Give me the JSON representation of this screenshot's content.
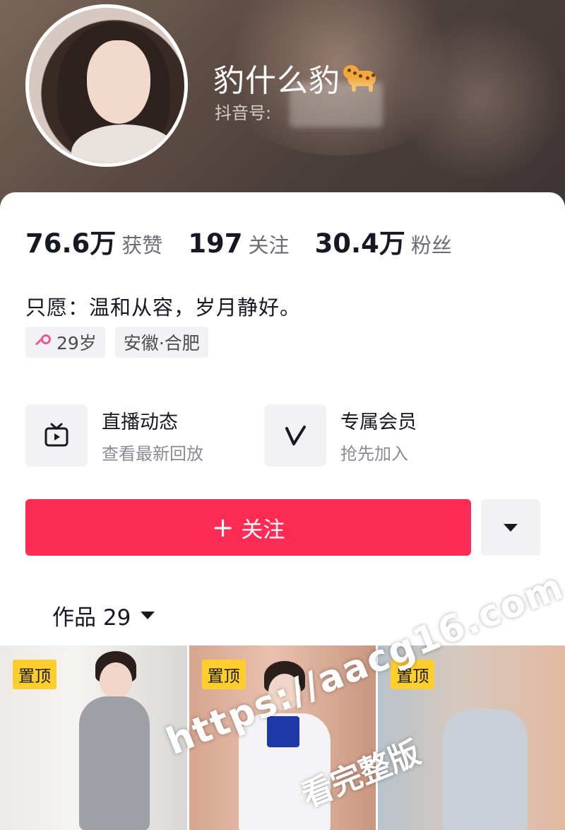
{
  "profile": {
    "name": "豹什么豹",
    "douyin_id_label": "抖音号:"
  },
  "stats": [
    {
      "value": "76.6万",
      "label": "获赞"
    },
    {
      "value": "197",
      "label": "关注"
    },
    {
      "value": "30.4万",
      "label": "粉丝"
    }
  ],
  "bio": "只愿：温和从容，岁月静好。",
  "tags": {
    "age": "29岁",
    "location": "安徽·合肥"
  },
  "features": [
    {
      "title": "直播动态",
      "subtitle": "查看最新回放",
      "icon": "tv-icon"
    },
    {
      "title": "专属会员",
      "subtitle": "抢先加入",
      "icon": "v-icon"
    }
  ],
  "actions": {
    "follow_label": "关注",
    "more_icon": "dropdown-triangle-icon"
  },
  "works": {
    "tab_label": "作品 29"
  },
  "thumbnails": [
    {
      "badge": "置顶"
    },
    {
      "badge": "置顶"
    },
    {
      "badge": "置顶"
    }
  ],
  "watermark": {
    "url": "https://aacg16.com",
    "text": "看完整版"
  },
  "colors": {
    "accent": "#fe2c55",
    "pin_badge": "#fece2c",
    "gender_female": "#f0549a"
  }
}
